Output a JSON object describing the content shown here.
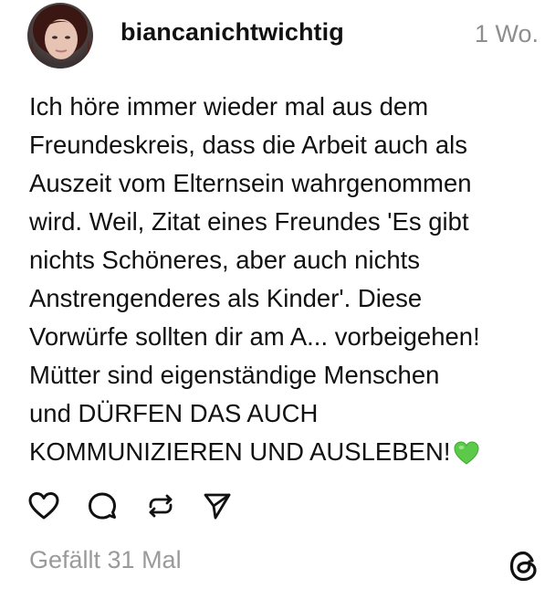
{
  "post": {
    "username": "biancanichtwichtig",
    "timestamp": "1 Wo.",
    "text": "Ich höre immer wieder mal aus dem\nFreundeskreis, dass die Arbeit auch als\nAuszeit vom Elternsein wahrgenommen\nwird. Weil, Zitat eines Freundes 'Es gibt\nnichts Schöneres, aber auch nichts\nAnstrengenderes als Kinder'. Diese\nVorwürfe sollten dir am A... vorbeigehen!\nMütter sind eigenständige Menschen\nund DÜRFEN DAS AUCH\nKOMMUNIZIEREN UND AUSLEBEN!",
    "emoji": "green-heart",
    "likes_label": "Gefällt 31 Mal"
  },
  "icons": {
    "like": "heart-icon",
    "comment": "comment-icon",
    "repost": "repost-icon",
    "share": "send-icon",
    "brand": "threads-logo-icon"
  },
  "colors": {
    "text": "#111111",
    "muted": "#8e8e8e",
    "heart_emoji": "#5cc94a"
  }
}
